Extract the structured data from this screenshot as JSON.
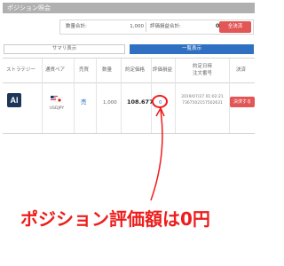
{
  "header": {
    "title": "ポジション照会"
  },
  "summary": {
    "quantity_label": "数量合計:",
    "quantity_value": "1,000",
    "pl_label": "評価損益合計:",
    "pl_value": "0円",
    "settle_all_label": "全決済"
  },
  "tabs": [
    {
      "label": "サマリ表示",
      "active": false
    },
    {
      "label": "一覧表示",
      "active": true
    }
  ],
  "table": {
    "headers": {
      "strategy": "ストラテジー",
      "pair": "通貨ペア",
      "side": "売買",
      "quantity": "数量",
      "price": "約定価格",
      "pl": "評価損益",
      "datetime_line1": "約定日時",
      "datetime_line2": "注文番号",
      "settle": "決済"
    },
    "rows": [
      {
        "strategy_logo": "AI",
        "pair": "USDJPY",
        "side": "売",
        "quantity": "1,000",
        "price": "108.677",
        "pl": "0",
        "datetime": "2019/07/27 01:02:21",
        "order_no": "7367502157502631",
        "settle_label": "決済する"
      }
    ]
  },
  "annotation": {
    "caption": "ポジション評価額は0円"
  },
  "colors": {
    "accent_blue": "#2f70c2",
    "settle_red": "#e25656",
    "annotation_red": "#ee1c1c",
    "header_gray": "#b0b0b0"
  },
  "icons": {
    "flags": "us-jp-flags-icon"
  }
}
